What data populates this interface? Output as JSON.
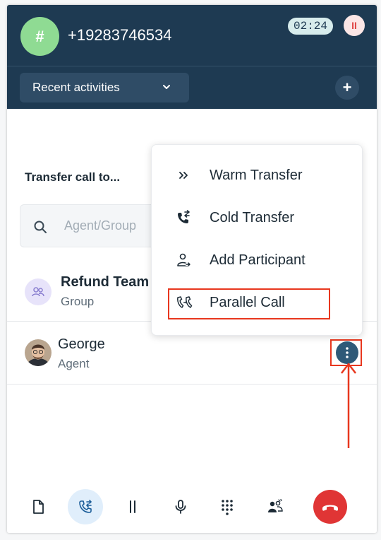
{
  "call": {
    "caller_initial": "#",
    "phone_number": "+19283746534",
    "timer": "02:24"
  },
  "activities": {
    "dropdown_label": "Recent activities"
  },
  "transfer": {
    "title": "Transfer call to...",
    "search_placeholder": "Agent/Group"
  },
  "contacts": [
    {
      "name": "Refund Team",
      "type": "Group"
    },
    {
      "name": "George",
      "type": "Agent"
    }
  ],
  "menu": {
    "items": [
      {
        "label": "Warm Transfer",
        "icon": "warm-transfer-icon"
      },
      {
        "label": "Cold Transfer",
        "icon": "cold-transfer-icon"
      },
      {
        "label": "Add Participant",
        "icon": "add-participant-icon"
      },
      {
        "label": "Parallel Call",
        "icon": "parallel-call-icon"
      }
    ]
  },
  "toolbar": {
    "items": [
      "notes-icon",
      "transfer-icon",
      "hold-icon",
      "mic-icon",
      "dialpad-icon",
      "conference-icon",
      "hangup-icon"
    ]
  },
  "colors": {
    "header": "#1e3a52",
    "accent": "#2f5a78",
    "highlight": "#e8371e",
    "hangup": "#e03535",
    "avatar": "#8fdb93"
  }
}
